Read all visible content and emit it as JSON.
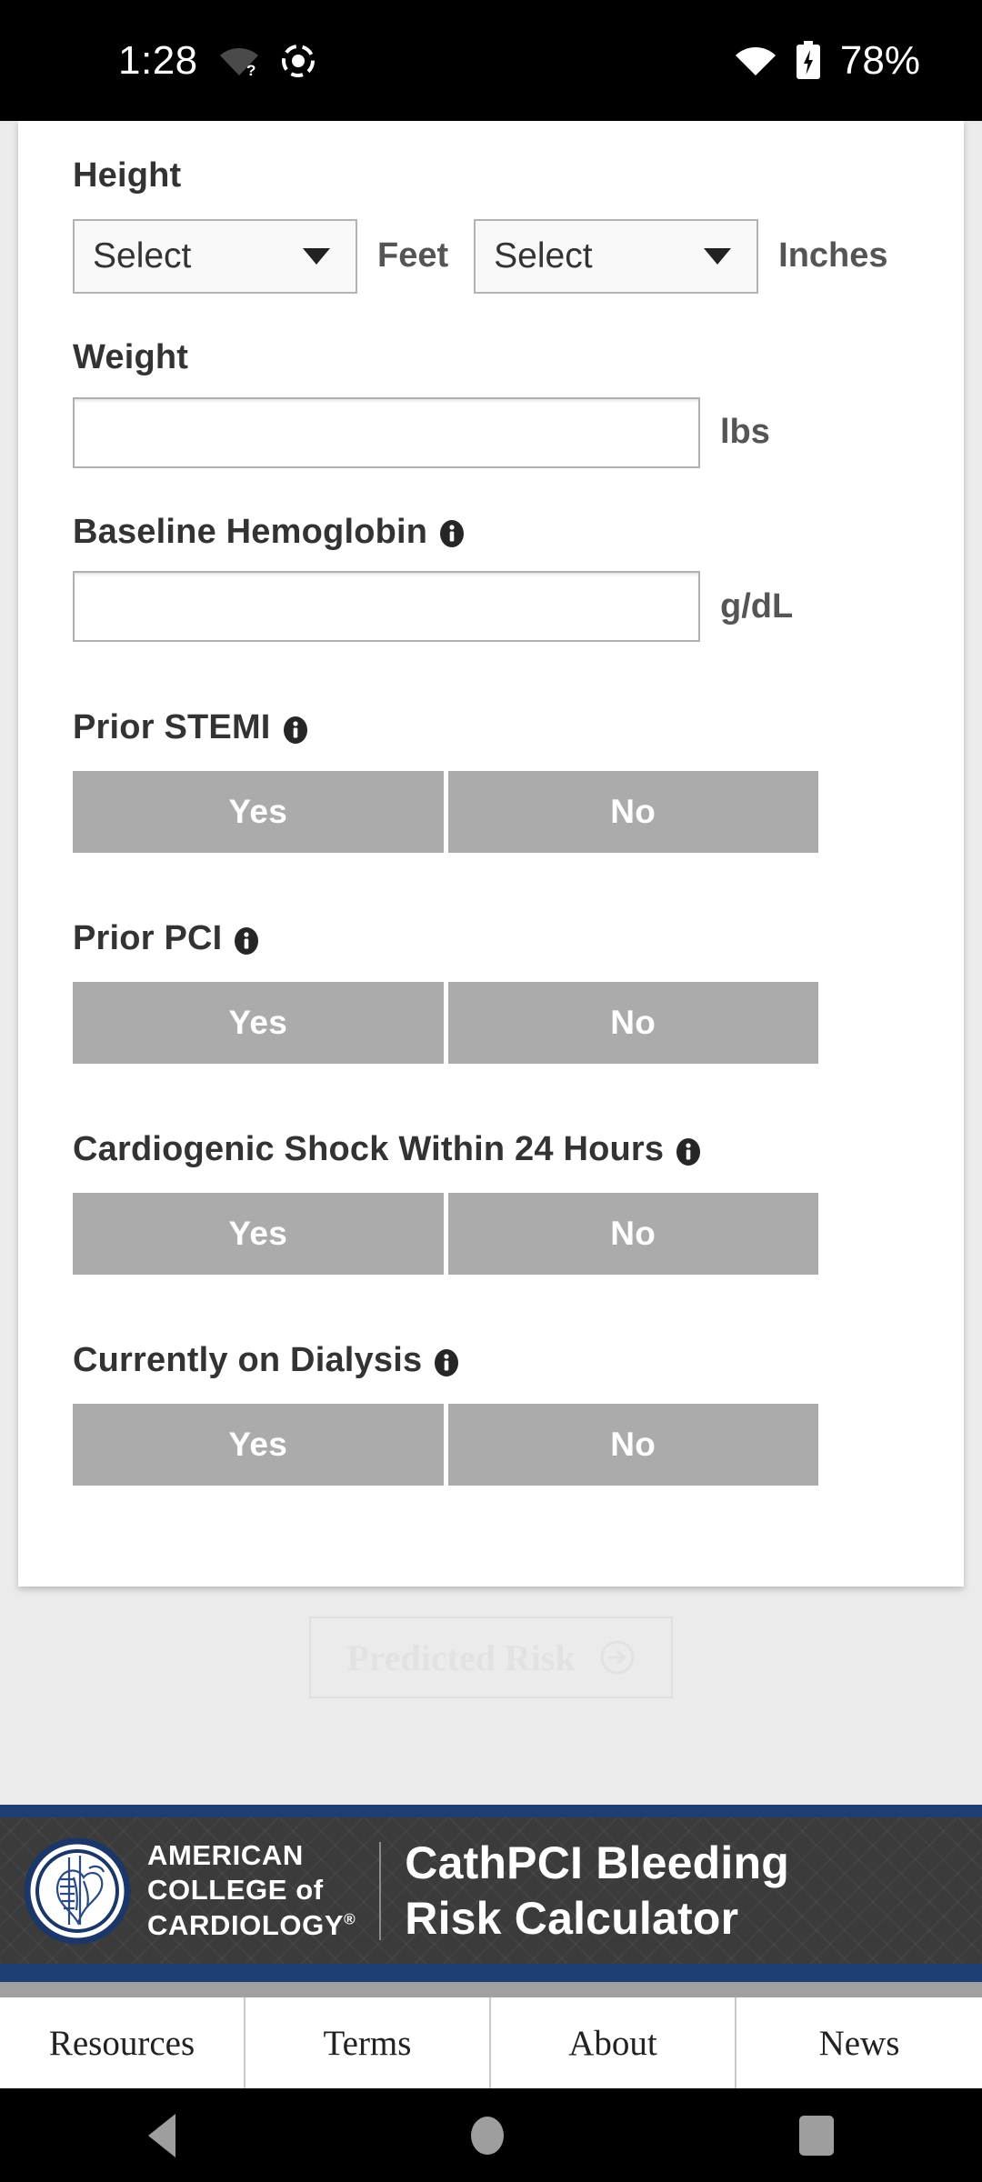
{
  "status_bar": {
    "time": "1:28",
    "wifi_icon": "wifi-question-icon",
    "screen_record_icon": "screen-record-icon",
    "wifi_signal_icon": "wifi-full-icon",
    "battery_icon": "battery-charging-icon",
    "battery_percent": "78%"
  },
  "form": {
    "height": {
      "label": "Height",
      "feet_select": {
        "value": "Select",
        "unit": "Feet"
      },
      "inches_select": {
        "value": "Select",
        "unit": "Inches"
      }
    },
    "weight": {
      "label": "Weight",
      "value": "",
      "placeholder": "",
      "unit": "lbs"
    },
    "hemoglobin": {
      "label": "Baseline Hemoglobin",
      "info_icon": "info-icon",
      "value": "",
      "placeholder": "",
      "unit": "g/dL"
    },
    "toggles": [
      {
        "label": "Prior STEMI",
        "info_icon": "info-icon",
        "yes": "Yes",
        "no": "No",
        "selected": ""
      },
      {
        "label": "Prior PCI",
        "info_icon": "info-icon",
        "yes": "Yes",
        "no": "No",
        "selected": ""
      },
      {
        "label": "Cardiogenic Shock Within 24 Hours",
        "info_icon": "info-icon",
        "yes": "Yes",
        "no": "No",
        "selected": ""
      },
      {
        "label": "Currently on Dialysis",
        "info_icon": "info-icon",
        "yes": "Yes",
        "no": "No",
        "selected": ""
      }
    ]
  },
  "predicted_risk": {
    "label": "Predicted Risk",
    "arrow_icon": "arrow-right-circle-icon",
    "state": "disabled"
  },
  "brand": {
    "logo_icon": "acc-heart-logo-icon",
    "org_line1": "AMERICAN",
    "org_line2": "COLLEGE of",
    "org_line3": "CARDIOLOGY",
    "registered_mark": "®",
    "title_line1": "CathPCI Bleeding",
    "title_line2": "Risk Calculator",
    "accent_color": "#1d3f73",
    "background_color": "#3b3b3b"
  },
  "tabs": [
    {
      "label": "Resources"
    },
    {
      "label": "Terms"
    },
    {
      "label": "About"
    },
    {
      "label": "News"
    }
  ],
  "android_nav": {
    "back_icon": "back-triangle-icon",
    "home_icon": "home-circle-icon",
    "recents_icon": "recents-square-icon"
  }
}
